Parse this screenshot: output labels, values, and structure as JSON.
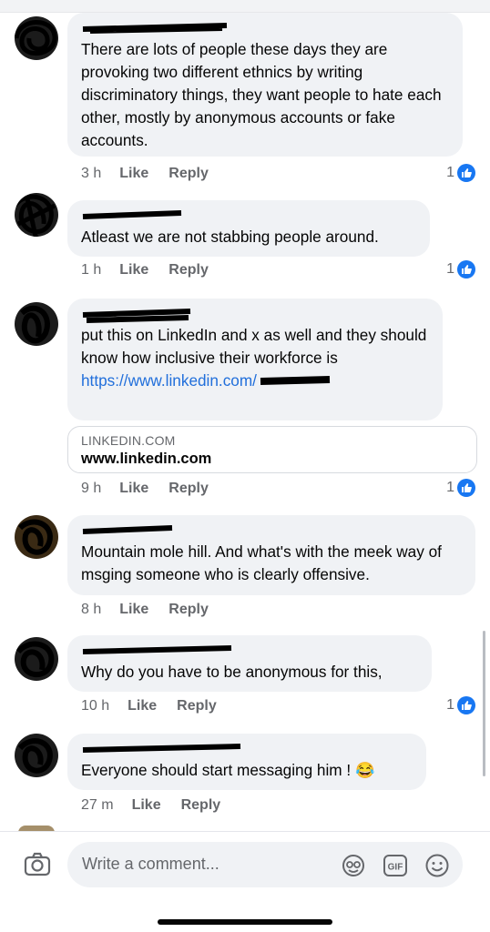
{
  "comments": [
    {
      "text": "There are lots of people these days they are provoking two different ethnics by writing discriminatory things, they want people to hate each other, mostly by anonymous accounts or fake accounts.",
      "time": "3 h",
      "like": "Like",
      "reply": "Reply",
      "reactions": "1"
    },
    {
      "text": "Atleast we are not stabbing people around.",
      "time": "1 h",
      "like": "Like",
      "reply": "Reply",
      "reactions": "1"
    },
    {
      "text": "put this on LinkedIn and x as well and they should know how inclusive their workforce is",
      "link": "https://www.linkedin.com/",
      "link_card": {
        "domain": "LINKEDIN.COM",
        "site": "www.linkedin.com"
      },
      "time": "9 h",
      "like": "Like",
      "reply": "Reply",
      "reactions": "1"
    },
    {
      "text": "Mountain mole hill. And what's with the meek way of msging someone who is clearly offensive.",
      "time": "8 h",
      "like": "Like",
      "reply": "Reply"
    },
    {
      "text": "Why do you have to be anonymous for this,",
      "time": "10 h",
      "like": "Like",
      "reply": "Reply",
      "reactions": "1"
    },
    {
      "text": "Everyone should start messaging him !",
      "emoji": "😂",
      "time": "27 m",
      "like": "Like",
      "reply": "Reply"
    }
  ],
  "composer": {
    "placeholder": "Write a comment...",
    "icons": [
      "camera-icon",
      "avatar-sticker-icon",
      "gif-icon",
      "emoji-icon"
    ]
  },
  "colors": {
    "accent": "#1877f2",
    "link": "#216fdb",
    "bubble": "#f0f2f5",
    "meta": "#65676b"
  }
}
